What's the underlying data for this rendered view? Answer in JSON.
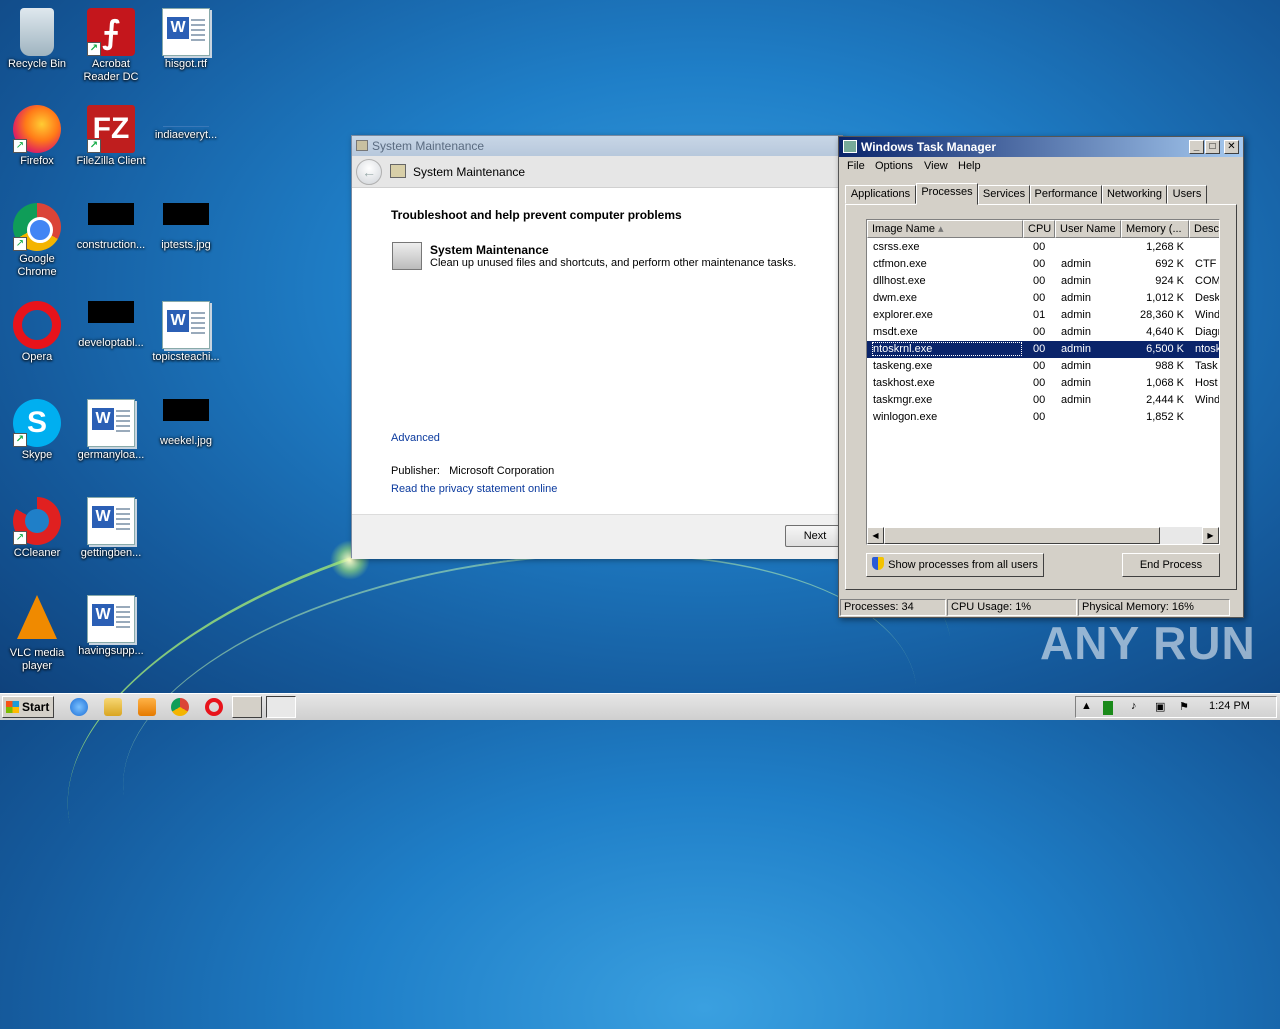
{
  "desktop": {
    "icons": [
      {
        "label": "Recycle Bin",
        "icon": "recycle-bin-icon"
      },
      {
        "label": "Acrobat\nReader DC",
        "icon": "acrobat-icon"
      },
      {
        "label": "hisgot.rtf",
        "icon": "word-document-icon"
      },
      {
        "label": "Firefox",
        "icon": "firefox-icon"
      },
      {
        "label": "FileZilla Client",
        "icon": "filezilla-icon"
      },
      {
        "label": "indiaeveryt...",
        "icon": "file-icon"
      },
      {
        "label": "Google\nChrome",
        "icon": "chrome-icon"
      },
      {
        "label": "construction...",
        "icon": "image-file-icon"
      },
      {
        "label": "iptests.jpg",
        "icon": "image-file-icon"
      },
      {
        "label": "Opera",
        "icon": "opera-icon"
      },
      {
        "label": "developtabl...",
        "icon": "image-file-icon"
      },
      {
        "label": "topicsteachi...",
        "icon": "word-document-icon"
      },
      {
        "label": "Skype",
        "icon": "skype-icon"
      },
      {
        "label": "germanyloa...",
        "icon": "word-document-icon"
      },
      {
        "label": "weekel.jpg",
        "icon": "image-file-icon"
      },
      {
        "label": "CCleaner",
        "icon": "ccleaner-icon"
      },
      {
        "label": "gettingben...",
        "icon": "word-document-icon"
      },
      {
        "label": "VLC media\nplayer",
        "icon": "vlc-icon"
      },
      {
        "label": "havingsupp...",
        "icon": "word-document-icon"
      }
    ]
  },
  "system_maintenance": {
    "window_title": "System Maintenance",
    "header_title": "System Maintenance",
    "heading": "Troubleshoot and help prevent computer problems",
    "item_title": "System Maintenance",
    "item_desc": "Clean up unused files and shortcuts, and perform other maintenance tasks.",
    "advanced_link": "Advanced",
    "publisher_label": "Publisher:",
    "publisher_value": "Microsoft Corporation",
    "privacy_link": "Read the privacy statement online",
    "next_button": "Next"
  },
  "task_manager": {
    "title": "Windows Task Manager",
    "menu": [
      "File",
      "Options",
      "View",
      "Help"
    ],
    "tabs": [
      "Applications",
      "Processes",
      "Services",
      "Performance",
      "Networking",
      "Users"
    ],
    "active_tab": "Processes",
    "columns": [
      "Image Name",
      "CPU",
      "User Name",
      "Memory (...",
      "Desc"
    ],
    "rows": [
      {
        "name": "csrss.exe",
        "cpu": "00",
        "user": "",
        "mem": "1,268 K",
        "desc": ""
      },
      {
        "name": "ctfmon.exe",
        "cpu": "00",
        "user": "admin",
        "mem": "692 K",
        "desc": "CTF L"
      },
      {
        "name": "dllhost.exe",
        "cpu": "00",
        "user": "admin",
        "mem": "924 K",
        "desc": "COM"
      },
      {
        "name": "dwm.exe",
        "cpu": "00",
        "user": "admin",
        "mem": "1,012 K",
        "desc": "Desk"
      },
      {
        "name": "explorer.exe",
        "cpu": "01",
        "user": "admin",
        "mem": "28,360 K",
        "desc": "Wind"
      },
      {
        "name": "msdt.exe",
        "cpu": "00",
        "user": "admin",
        "mem": "4,640 K",
        "desc": "Diagn"
      },
      {
        "name": "ntoskrnl.exe",
        "cpu": "00",
        "user": "admin",
        "mem": "6,500 K",
        "desc": "ntosk"
      },
      {
        "name": "taskeng.exe",
        "cpu": "00",
        "user": "admin",
        "mem": "988 K",
        "desc": "Task"
      },
      {
        "name": "taskhost.exe",
        "cpu": "00",
        "user": "admin",
        "mem": "1,068 K",
        "desc": "Host"
      },
      {
        "name": "taskmgr.exe",
        "cpu": "00",
        "user": "admin",
        "mem": "2,444 K",
        "desc": "Wind"
      },
      {
        "name": "winlogon.exe",
        "cpu": "00",
        "user": "",
        "mem": "1,852 K",
        "desc": ""
      }
    ],
    "selected_row": "ntoskrnl.exe",
    "show_all_button": "Show processes from all users",
    "end_process_button": "End Process",
    "status_processes": "Processes: 34",
    "status_cpu": "CPU Usage: 1%",
    "status_memory": "Physical Memory: 16%"
  },
  "watermark": "ANY RUN",
  "taskbar": {
    "start_label": "Start",
    "clock": "1:24 PM"
  }
}
